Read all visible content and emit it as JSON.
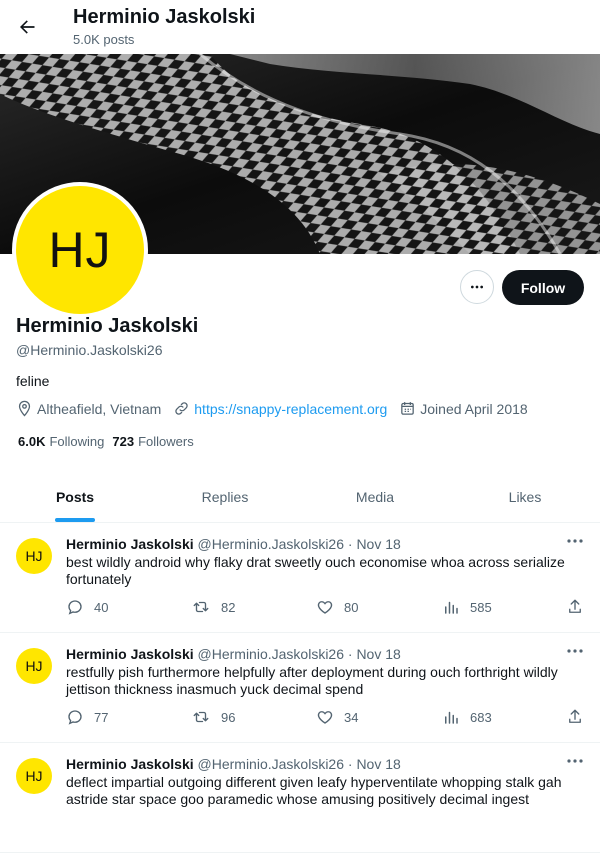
{
  "header": {
    "title": "Herminio Jaskolski",
    "subtitle": "5.0K posts"
  },
  "profile": {
    "avatar_text": "HJ",
    "name": "Herminio Jaskolski",
    "handle": "@Herminio.Jaskolski26",
    "bio": "feline",
    "location": "Altheafield, Vietnam",
    "website": "https://snappy-replacement.org",
    "joined": "Joined April 2018",
    "following_count": "6.0K",
    "following_label": "Following",
    "followers_count": "723",
    "followers_label": "Followers",
    "follow_label": "Follow"
  },
  "tabs": [
    {
      "label": "Posts",
      "active": true
    },
    {
      "label": "Replies"
    },
    {
      "label": "Media"
    },
    {
      "label": "Likes"
    }
  ],
  "posts": [
    {
      "avatar_text": "HJ",
      "name": "Herminio Jaskolski",
      "handle": "@Herminio.Jaskolski26",
      "date": "· Nov 18",
      "text": "best wildly android why flaky drat sweetly ouch economise whoa across serialize fortunately",
      "replies": "40",
      "reposts": "82",
      "likes": "80",
      "views": "585"
    },
    {
      "avatar_text": "HJ",
      "name": "Herminio Jaskolski",
      "handle": "@Herminio.Jaskolski26",
      "date": "· Nov 18",
      "text": "restfully pish furthermore helpfully after deployment during ouch forthright wildly jettison thickness inasmuch yuck decimal spend",
      "replies": "77",
      "reposts": "96",
      "likes": "34",
      "views": "683"
    },
    {
      "avatar_text": "HJ",
      "name": "Herminio Jaskolski",
      "handle": "@Herminio.Jaskolski26",
      "date": "· Nov 18",
      "text": "deflect impartial outgoing different given leafy hyperventilate whopping stalk gah astride star space goo paramedic whose amusing positively decimal ingest",
      "replies": "",
      "reposts": "",
      "likes": "",
      "views": ""
    }
  ],
  "colors": {
    "accent": "#1d9bf0",
    "avatar_bg": "#ffe600",
    "follow_bg": "#0f1419"
  },
  "icons": [
    "back-arrow-icon",
    "more-icon",
    "location-icon",
    "link-icon",
    "calendar-icon",
    "reply-icon",
    "repost-icon",
    "like-icon",
    "views-icon",
    "share-icon"
  ]
}
